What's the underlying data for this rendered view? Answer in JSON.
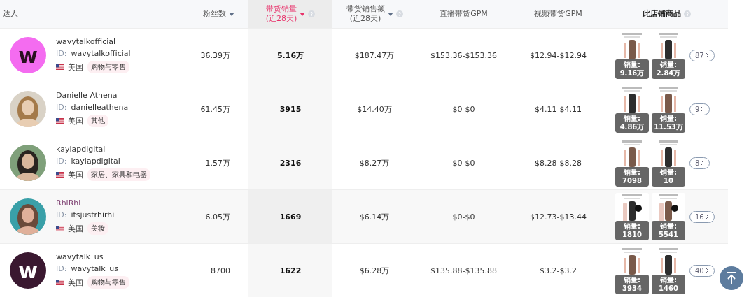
{
  "columns": [
    {
      "label": "达人",
      "sort_active": false,
      "emphasis": false
    },
    {
      "label": "粉丝数",
      "sortable": true,
      "sort_active": false,
      "emphasis": false
    },
    {
      "label": "带货销量",
      "sub": "(近28天)",
      "sortable": true,
      "sort_active": true,
      "help": true,
      "emphasis": false
    },
    {
      "label": "带货销售额",
      "sub": "(近28天)",
      "sortable": true,
      "sort_active": false,
      "help": true,
      "emphasis": false
    },
    {
      "label": "直播带货GPM",
      "sort_active": false,
      "emphasis": false
    },
    {
      "label": "视频带货GPM",
      "sort_active": false,
      "emphasis": false
    },
    {
      "label": "此店铺商品",
      "sort_active": false,
      "help": true,
      "emphasis": true
    }
  ],
  "rows": [
    {
      "highlighted": false,
      "avatar": {
        "kind": "logo",
        "letter": "w",
        "color": "#f46cf0"
      },
      "name": "wavytalkofficial",
      "id_label": "ID:",
      "id": "wavytalkofficial",
      "country": "美国",
      "category": "购物与零售",
      "fans": "36.39万",
      "sales": "5.16万",
      "revenue": "$187.47万",
      "live_gpm": "$153.36-$153.36",
      "video_gpm": "$12.94-$12.94",
      "products": [
        {
          "sales_label": "销量:",
          "sales": "9.16万"
        },
        {
          "sales_label": "销量:",
          "sales": "2.84万"
        }
      ],
      "more": "87"
    },
    {
      "highlighted": false,
      "name": "Danielle Athena",
      "id_label": "ID:",
      "id": "danielleathena",
      "country": "美国",
      "category": "其他",
      "fans": "61.45万",
      "sales": "3915",
      "revenue": "$14.40万",
      "live_gpm": "$0-$0",
      "video_gpm": "$4.11-$4.11",
      "products": [
        {
          "sales_label": "销量:",
          "sales": "4.86万"
        },
        {
          "sales_label": "销量:",
          "sales": "11.53万"
        }
      ],
      "more": "9"
    },
    {
      "highlighted": false,
      "name": "kaylapdigital",
      "id_label": "ID:",
      "id": "kaylapdigital",
      "country": "美国",
      "category": "家居、家具和电器",
      "fans": "1.57万",
      "sales": "2316",
      "revenue": "$8.27万",
      "live_gpm": "$0-$0",
      "video_gpm": "$8.28-$8.28",
      "products": [
        {
          "sales_label": "销量:",
          "sales": "7098"
        },
        {
          "sales_label": "销量:",
          "sales": "10"
        }
      ],
      "more": "8"
    },
    {
      "highlighted": true,
      "name": "RhiRhi",
      "id_label": "ID:",
      "id": "itsjustrhirhi",
      "country": "美国",
      "category": "美妆",
      "fans": "6.05万",
      "sales": "1669",
      "revenue": "$6.14万",
      "live_gpm": "$0-$0",
      "video_gpm": "$12.73-$13.44",
      "products": [
        {
          "sales_label": "销量:",
          "sales": "1810"
        },
        {
          "sales_label": "销量:",
          "sales": "5541"
        }
      ],
      "more": "16"
    },
    {
      "highlighted": false,
      "avatar": {
        "kind": "logo",
        "letter": "w",
        "color": "#3a1830"
      },
      "name": "wavytalk_us",
      "id_label": "ID:",
      "id": "wavytalk_us",
      "country": "美国",
      "category": "购物与零售",
      "fans": "8700",
      "sales": "1622",
      "revenue": "$6.28万",
      "live_gpm": "$135.88-$135.88",
      "video_gpm": "$3.2-$3.2",
      "products": [
        {
          "sales_label": "销量:",
          "sales": "3934"
        },
        {
          "sales_label": "销量:",
          "sales": "1460"
        }
      ],
      "more": "40"
    }
  ]
}
